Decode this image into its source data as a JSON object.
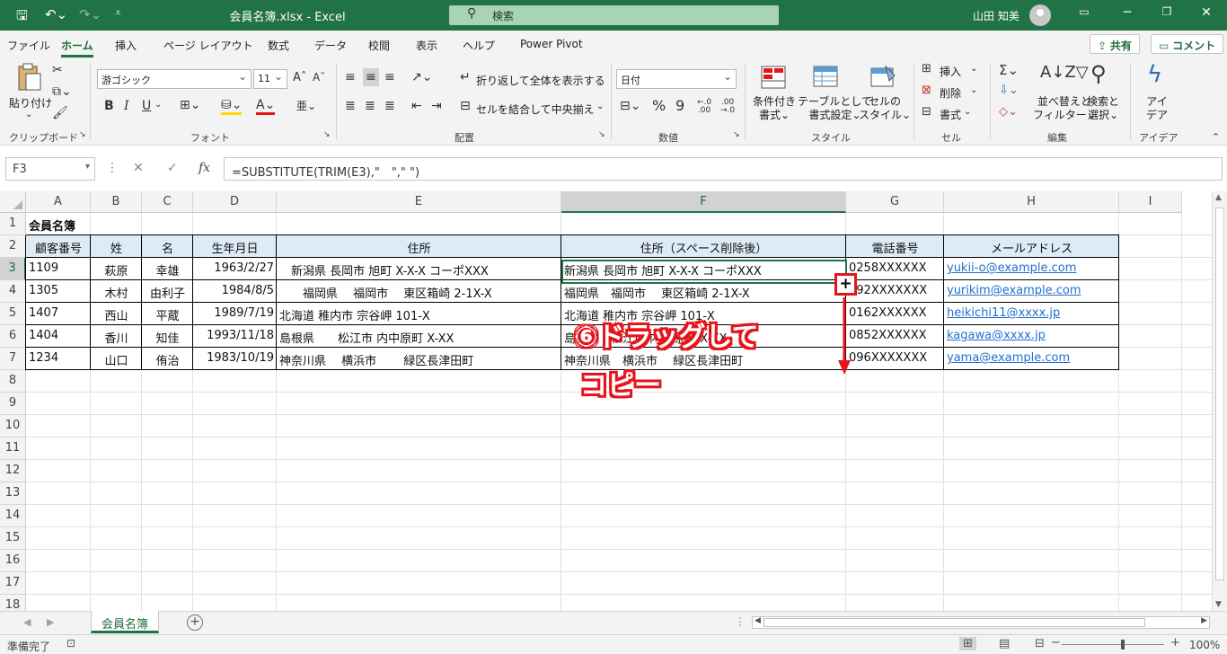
{
  "titlebar": {
    "title": "会員名簿.xlsx  -  Excel",
    "search_placeholder": "検索",
    "user": "山田 知美",
    "bg_color": "#217346"
  },
  "menu": {
    "tabs": [
      "ファイル",
      "ホーム",
      "挿入",
      "ページ レイアウト",
      "数式",
      "データ",
      "校閲",
      "表示",
      "ヘルプ",
      "Power Pivot"
    ],
    "active_tab": "ホーム",
    "share": "共有",
    "comment": "コメント"
  },
  "ribbon": {
    "clipboard": {
      "paste": "貼り付け",
      "group": "クリップボード"
    },
    "font": {
      "family": "游ゴシック",
      "size": "11",
      "group": "フォント",
      "bold": "B",
      "italic": "I",
      "underline": "U"
    },
    "alignment": {
      "wrap": "折り返して全体を表示する",
      "merge": "セルを結合して中央揃え",
      "group": "配置"
    },
    "number": {
      "format": "日付",
      "group": "数値"
    },
    "styles": {
      "conditional": [
        "条件付き",
        "書式"
      ],
      "table": [
        "テーブルとして",
        "書式設定"
      ],
      "cell": [
        "セルの",
        "スタイル"
      ],
      "group": "スタイル"
    },
    "cells": {
      "insert": "挿入",
      "delete": "削除",
      "format": "書式",
      "group": "セル"
    },
    "editing": {
      "sort": [
        "並べ替えと",
        "フィルター"
      ],
      "find": [
        "検索と",
        "選択"
      ],
      "group": "編集"
    },
    "ideas": {
      "label": [
        "アイ",
        "デア"
      ],
      "group": "アイデア"
    }
  },
  "formula_bar": {
    "name_box": "F3",
    "formula": "=SUBSTITUTE(TRIM(E3),\"　\",\" \")"
  },
  "columns": [
    "A",
    "B",
    "C",
    "D",
    "E",
    "F",
    "G",
    "H",
    "I"
  ],
  "rows": [
    "1",
    "2",
    "3",
    "4",
    "5",
    "6",
    "7",
    "8",
    "9",
    "10",
    "11",
    "12",
    "13",
    "14",
    "15",
    "16",
    "17",
    "18"
  ],
  "sheet": {
    "title": "会員名簿",
    "headers": [
      "顧客番号",
      "姓",
      "名",
      "生年月日",
      "住所",
      "住所（スペース削除後）",
      "電話番号",
      "メールアドレス"
    ],
    "records": [
      [
        "1109",
        "萩原",
        "幸雄",
        "1963/2/27",
        "　新潟県  長岡市 旭町 X-X-X コーポXXX",
        "新潟県 長岡市 旭町 X-X-X コーポXXX",
        "0258XXXXXX",
        "yukii-o@example.com"
      ],
      [
        "1305",
        "木村",
        "由利子",
        "1984/8/5",
        "　　福岡県　 福岡市　 東区箱崎 2-1X-X",
        "福岡県　福岡市　 東区箱崎 2-1X-X",
        "092XXXXXXX",
        "yurikim@example.com"
      ],
      [
        "1407",
        "西山",
        "平蔵",
        "1989/7/19",
        "北海道 稚内市 宗谷岬 101-X",
        "北海道 稚内市 宗谷岬 101-X",
        "0162XXXXXX",
        "heikichi11@xxxx.jp"
      ],
      [
        "1404",
        "香川",
        "知佳",
        "1993/11/18",
        "島根県　　松江市 内中原町 X-XX",
        "島根県　松江市 内中原町 X-XX",
        "0852XXXXXX",
        "kagawa@xxxx.jp"
      ],
      [
        "1234",
        "山口",
        "侑治",
        "1983/10/19",
        "神奈川県　 横浜市　　 緑区長津田町",
        "神奈川県　横浜市　 緑区長津田町",
        "096XXXXXXX",
        "yama@example.com"
      ]
    ]
  },
  "annotation": {
    "line1": "⑥ドラッグして",
    "line2": "コピー",
    "color": "#e8141b"
  },
  "sheet_tabs": {
    "active": "会員名簿"
  },
  "status": {
    "text": "準備完了",
    "zoom": "100%"
  }
}
